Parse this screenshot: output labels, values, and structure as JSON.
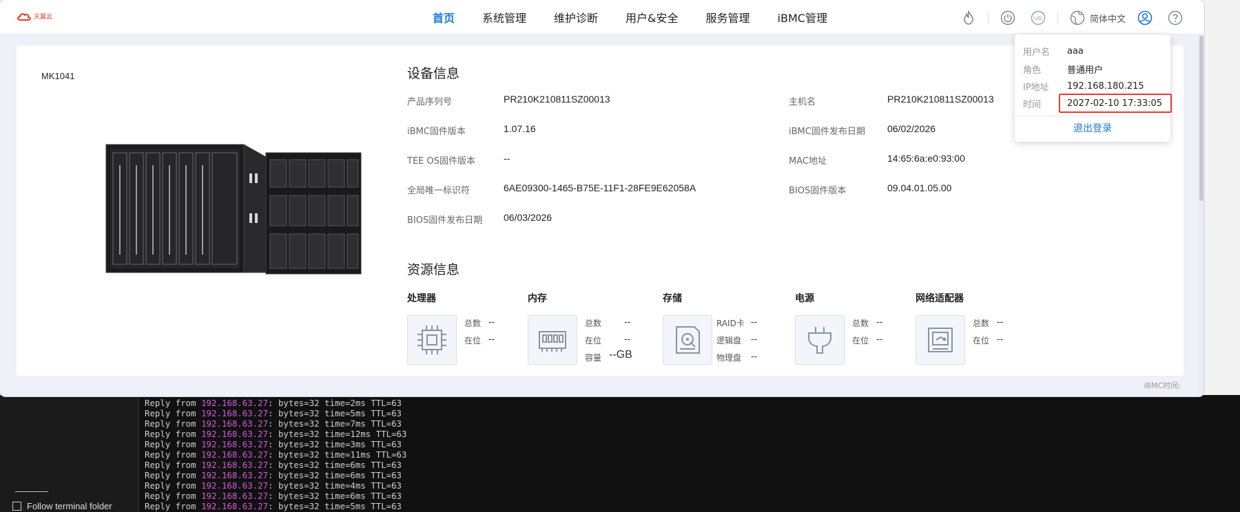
{
  "logo": {
    "text": "天翼云",
    "color": "#e23b2c"
  },
  "nav": {
    "items": [
      {
        "label": "首页",
        "active": true
      },
      {
        "label": "系统管理",
        "active": false
      },
      {
        "label": "维护诊断",
        "active": false
      },
      {
        "label": "用户&安全",
        "active": false
      },
      {
        "label": "服务管理",
        "active": false
      },
      {
        "label": "iBMC管理",
        "active": false
      }
    ]
  },
  "toolbar": {
    "icons": [
      "flame-icon",
      "power-icon",
      "uid-icon",
      "globe-icon",
      "user-icon",
      "help-icon"
    ],
    "uid_label": "UID",
    "language": "简体中文"
  },
  "device": {
    "model": "MK1041",
    "section_title": "设备信息",
    "fields_left": [
      {
        "label": "产品序列号",
        "value": "PR210K210811SZ00013"
      },
      {
        "label": "iBMC固件版本",
        "value": "1.07.16"
      },
      {
        "label": "TEE OS固件版本",
        "value": "--"
      },
      {
        "label": "全局唯一标识符",
        "value": "6AE09300-1465-B75E-11F1-28FE9E62058A"
      },
      {
        "label": "BIOS固件发布日期",
        "value": "06/03/2026"
      }
    ],
    "fields_right": [
      {
        "label": "主机名",
        "value": "PR210K210811SZ00013"
      },
      {
        "label": "iBMC固件发布日期",
        "value": "06/02/2026"
      },
      {
        "label": "MAC地址",
        "value": "14:65:6a:e0:93:00"
      },
      {
        "label": "BIOS固件版本",
        "value": "09.04.01.05.00"
      }
    ]
  },
  "resources": {
    "section_title": "资源信息",
    "processor": {
      "title": "处理器",
      "total_label": "总数",
      "total": "--",
      "present_label": "在位",
      "present": "--"
    },
    "memory": {
      "title": "内存",
      "total_label": "总数",
      "total": "--",
      "present_label": "在位",
      "present": "--",
      "capacity_label": "容量",
      "capacity": "--GB"
    },
    "storage": {
      "title": "存储",
      "raid_label": "RAID卡",
      "raid": "--",
      "logical_label": "逻辑盘",
      "logical": "--",
      "physical_label": "物理盘",
      "physical": "--"
    },
    "power": {
      "title": "电源",
      "total_label": "总数",
      "total": "--",
      "present_label": "在位",
      "present": "--"
    },
    "network": {
      "title": "网络适配器",
      "total_label": "总数",
      "total": "--",
      "present_label": "在位",
      "present": "--"
    }
  },
  "footer": {
    "ibmc_time_label": "iBMC时间:"
  },
  "user_popover": {
    "username_label": "用户名",
    "username": "aaa",
    "role_label": "角色",
    "role": "普通用户",
    "ip_label": "IP地址",
    "ip": "192.168.180.215",
    "time_label": "时间",
    "time": "2027-02-10 17:33:05",
    "logout": "退出登录"
  },
  "terminal": {
    "follow_folder": "Follow terminal folder",
    "lines": [
      {
        "prefix": "Reply from ",
        "ip": "192.168.63.27",
        "suffix": ": bytes=32 time=2ms TTL=63"
      },
      {
        "prefix": "Reply from ",
        "ip": "192.168.63.27",
        "suffix": ": bytes=32 time=5ms TTL=63"
      },
      {
        "prefix": "Reply from ",
        "ip": "192.168.63.27",
        "suffix": ": bytes=32 time=7ms TTL=63"
      },
      {
        "prefix": "Reply from ",
        "ip": "192.168.63.27",
        "suffix": ": bytes=32 time=12ms TTL=63"
      },
      {
        "prefix": "Reply from ",
        "ip": "192.168.63.27",
        "suffix": ": bytes=32 time=3ms TTL=63"
      },
      {
        "prefix": "Reply from ",
        "ip": "192.168.63.27",
        "suffix": ": bytes=32 time=11ms TTL=63"
      },
      {
        "prefix": "Reply from ",
        "ip": "192.168.63.27",
        "suffix": ": bytes=32 time=6ms TTL=63"
      },
      {
        "prefix": "Reply from ",
        "ip": "192.168.63.27",
        "suffix": ": bytes=32 time=6ms TTL=63"
      },
      {
        "prefix": "Reply from ",
        "ip": "192.168.63.27",
        "suffix": ": bytes=32 time=4ms TTL=63"
      },
      {
        "prefix": "Reply from ",
        "ip": "192.168.63.27",
        "suffix": ": bytes=32 time=6ms TTL=63"
      },
      {
        "prefix": "Reply from ",
        "ip": "192.168.63.27",
        "suffix": ": bytes=32 time=5ms TTL=63"
      }
    ]
  },
  "colors": {
    "accent": "#1677d6",
    "highlight_box": "#e43b2f",
    "terminal_ip": "#d35bd6"
  }
}
